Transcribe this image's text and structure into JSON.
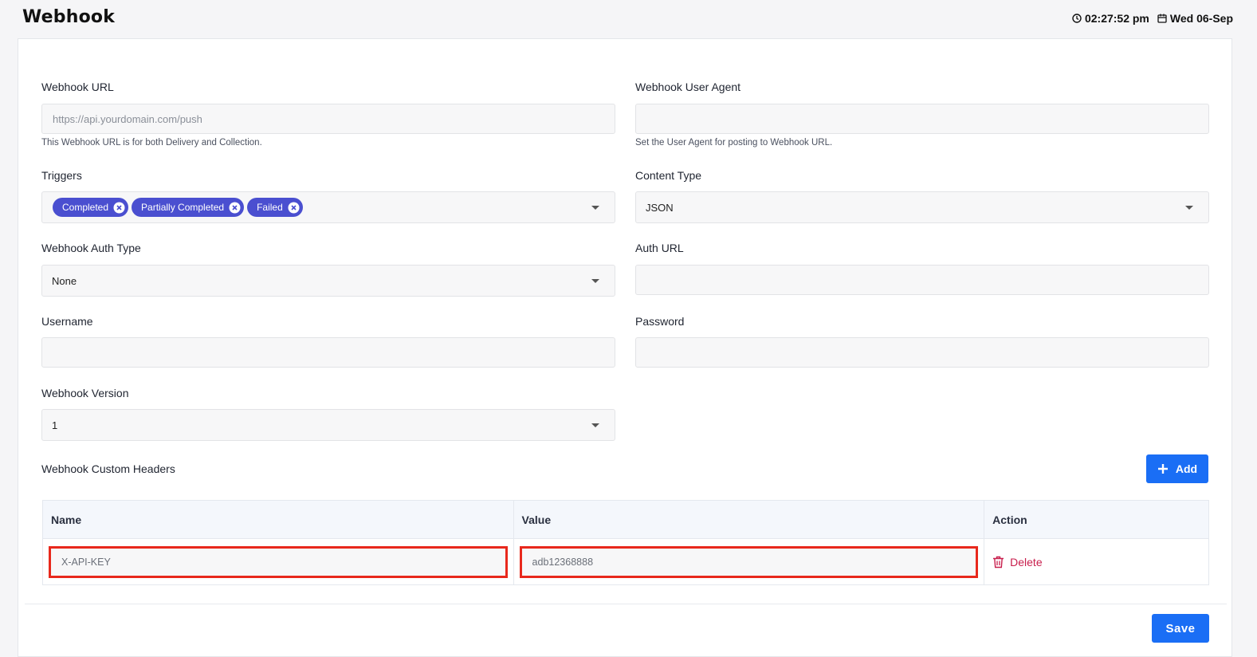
{
  "header": {
    "title": "Webhook",
    "time": "02:27:52 pm",
    "date": "Wed 06-Sep",
    "time_icon": "clock-icon",
    "date_icon": "calendar-icon"
  },
  "form": {
    "webhook_url": {
      "label": "Webhook URL",
      "value": "",
      "placeholder": "https://api.yourdomain.com/push",
      "help": "This Webhook URL is for both Delivery and Collection."
    },
    "user_agent": {
      "label": "Webhook User Agent",
      "value": "",
      "placeholder": "",
      "help": "Set the User Agent for posting to Webhook URL."
    },
    "triggers": {
      "label": "Triggers",
      "selected": [
        "Completed",
        "Partially Completed",
        "Failed"
      ]
    },
    "content_type": {
      "label": "Content Type",
      "value": "JSON"
    },
    "auth_type": {
      "label": "Webhook Auth Type",
      "value": "None"
    },
    "auth_url": {
      "label": "Auth URL",
      "value": ""
    },
    "username": {
      "label": "Username",
      "value": ""
    },
    "password": {
      "label": "Password",
      "value": ""
    },
    "version": {
      "label": "Webhook Version",
      "value": "1"
    }
  },
  "custom_headers": {
    "label": "Webhook Custom Headers",
    "add_label": "Add",
    "columns": [
      "Name",
      "Value",
      "Action"
    ],
    "rows": [
      {
        "name": "X-API-KEY",
        "value": "adb12368888",
        "action": "Delete"
      }
    ]
  },
  "footer": {
    "save_label": "Save"
  },
  "colors": {
    "primary": "#1a6ef5",
    "chip": "#4a4fd0",
    "danger": "#c81e4c",
    "highlight": "#e8281c"
  }
}
